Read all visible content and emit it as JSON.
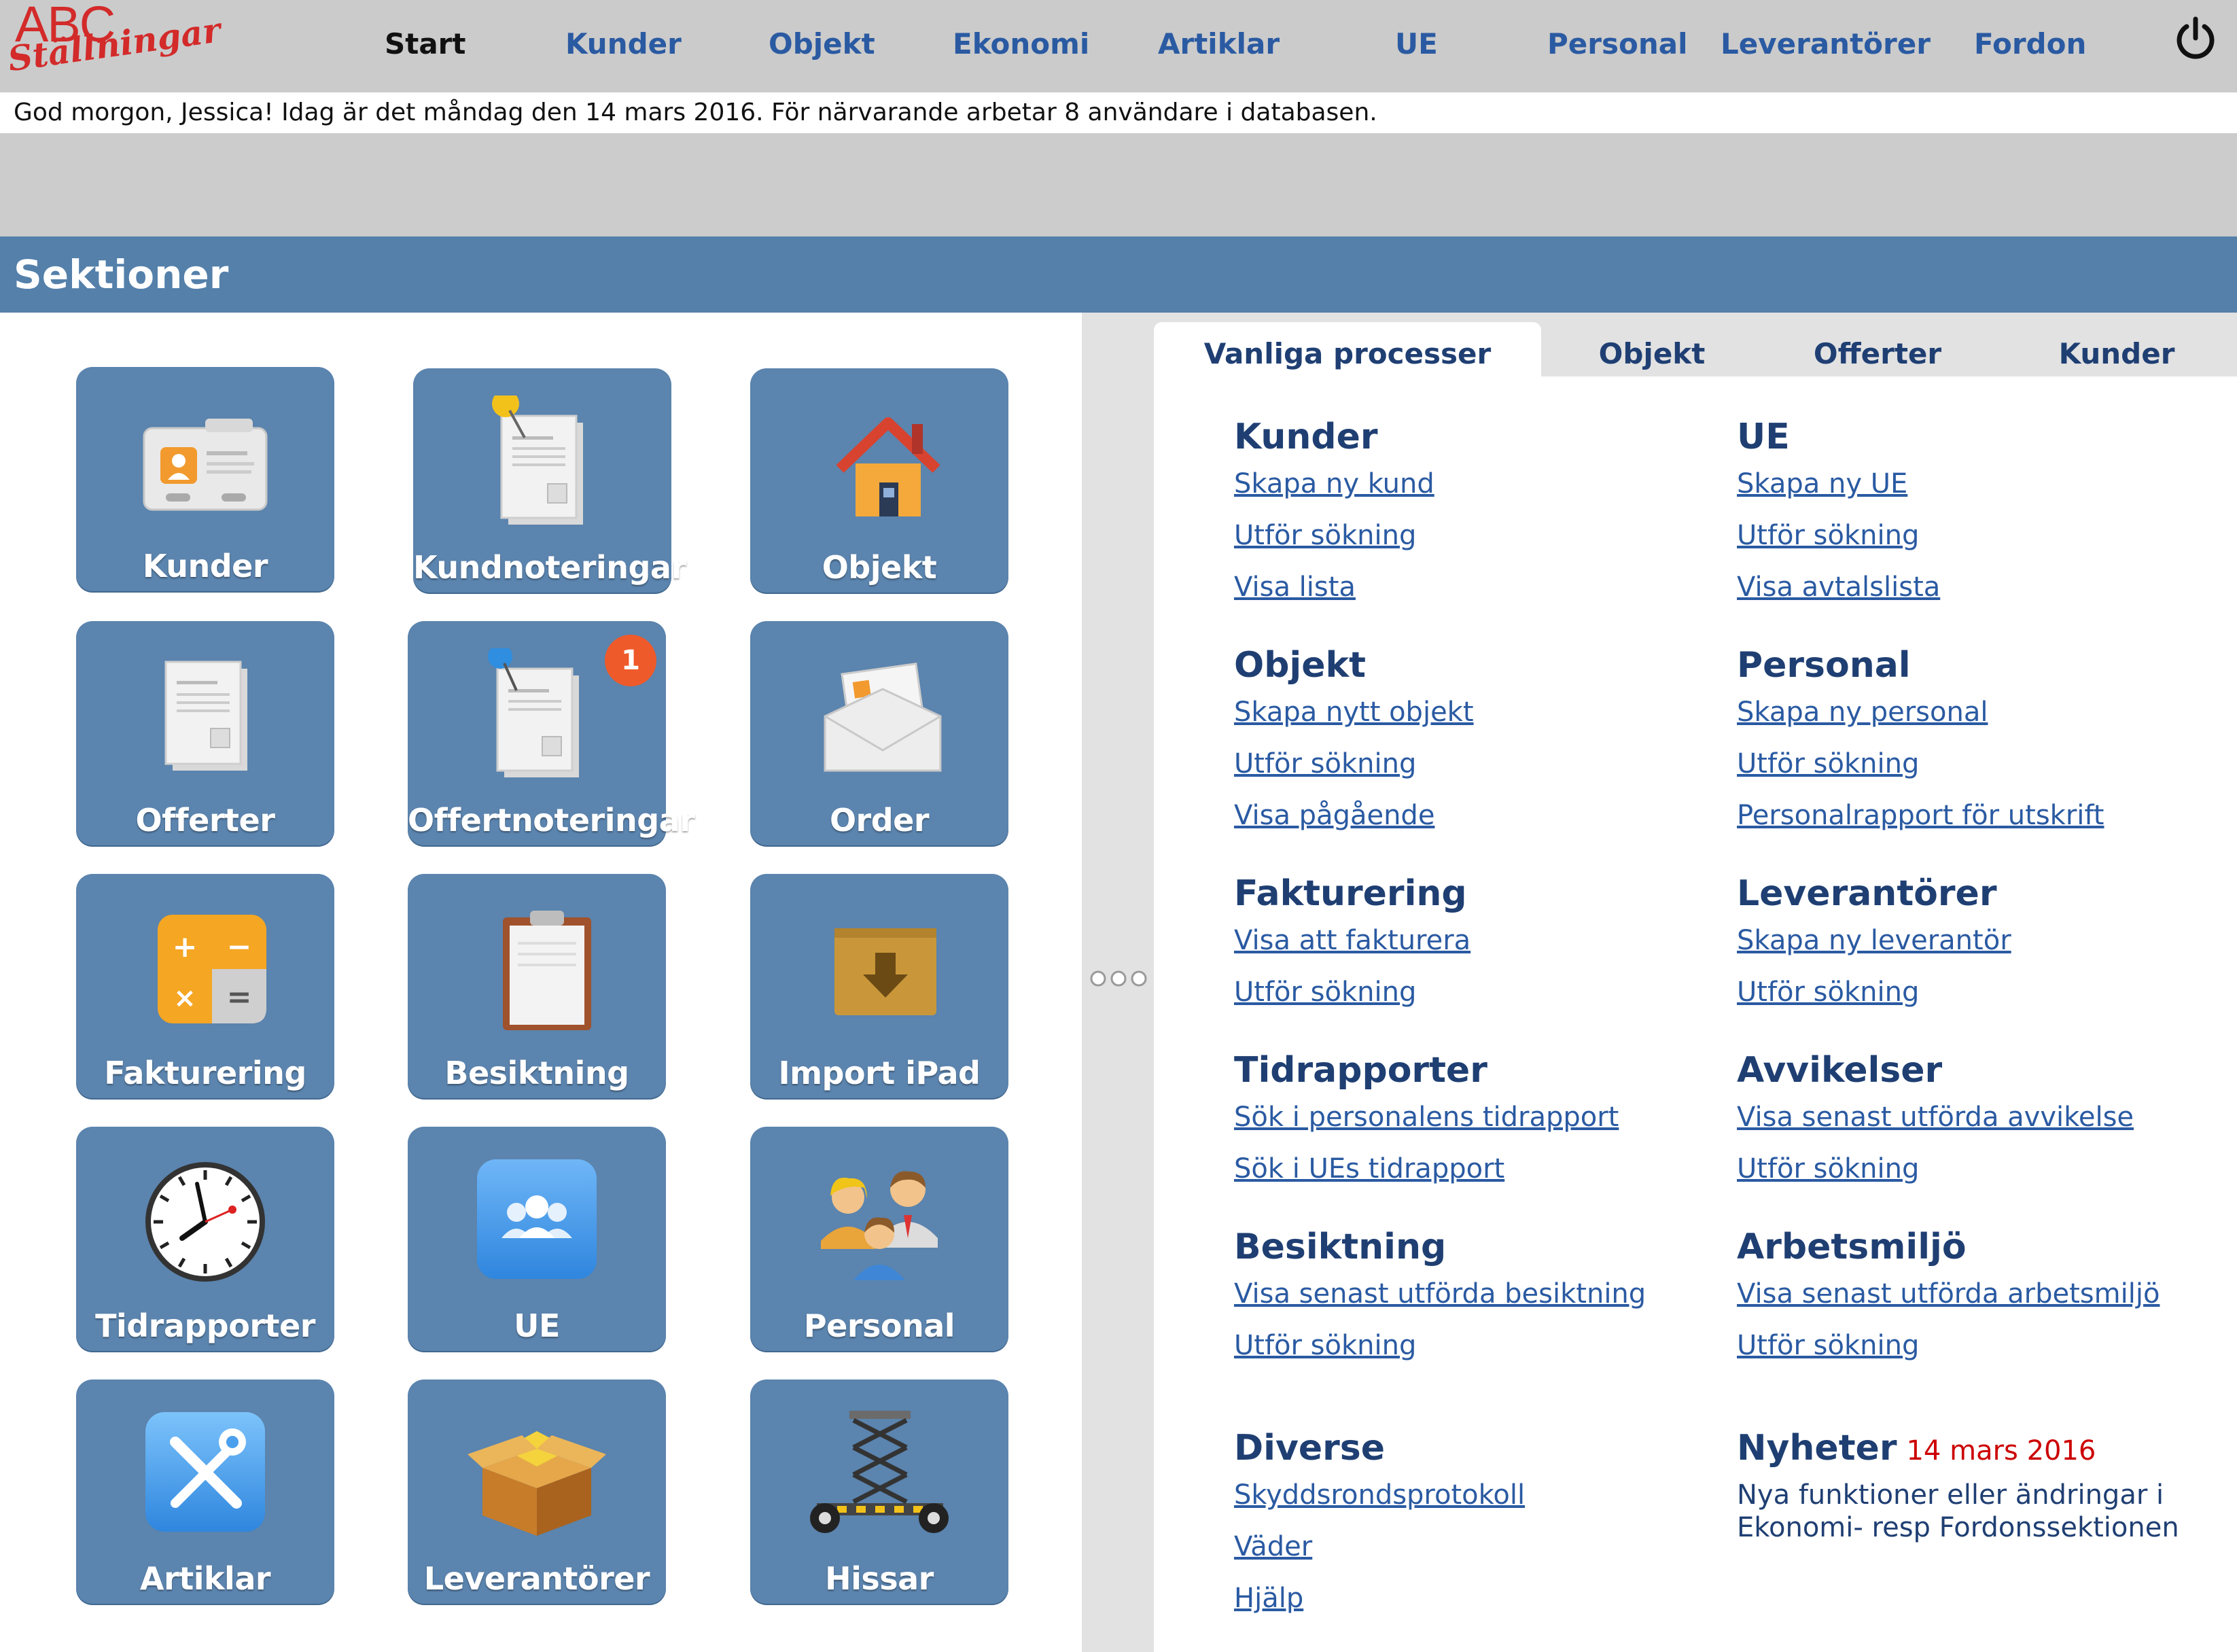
{
  "logo": {
    "line1": "ABC",
    "line2": "Ställningar"
  },
  "nav": {
    "items": [
      "Start",
      "Kunder",
      "Objekt",
      "Ekonomi",
      "Artiklar",
      "UE",
      "Personal",
      "Leverantörer",
      "Fordon"
    ],
    "active": "Start"
  },
  "greeting": "God morgon, Jessica! Idag är det måndag den 14 mars 2016. För närvarande arbetar 8 användare i databasen.",
  "section_title": "Sektioner",
  "tiles": [
    {
      "label": "Kunder",
      "icon": "contact-card-icon"
    },
    {
      "label": "Kundnoteringar",
      "icon": "pinned-note-icon"
    },
    {
      "label": "Objekt",
      "icon": "house-icon"
    },
    {
      "label": "Offerter",
      "icon": "document-icon"
    },
    {
      "label": "Offertnoteringar",
      "icon": "pinned-note-icon",
      "badge": "1"
    },
    {
      "label": "Order",
      "icon": "envelope-icon"
    },
    {
      "label": "Fakturering",
      "icon": "calculator-icon"
    },
    {
      "label": "Besiktning",
      "icon": "clipboard-icon"
    },
    {
      "label": "Import iPad",
      "icon": "download-box-icon"
    },
    {
      "label": "Tidrapporter",
      "icon": "clock-icon"
    },
    {
      "label": "UE",
      "icon": "group-icon"
    },
    {
      "label": "Personal",
      "icon": "people-icon"
    },
    {
      "label": "Artiklar",
      "icon": "tools-icon"
    },
    {
      "label": "Leverantörer",
      "icon": "package-icon"
    },
    {
      "label": "Hissar",
      "icon": "scissor-lift-icon"
    }
  ],
  "tabs": [
    "Vanliga processer",
    "Objekt",
    "Offerter",
    "Kunder"
  ],
  "active_tab": "Vanliga processer",
  "groups": {
    "kunder": {
      "title": "Kunder",
      "links": [
        "Skapa ny kund",
        "Utför sökning",
        "Visa lista"
      ]
    },
    "ue": {
      "title": "UE",
      "links": [
        "Skapa ny UE",
        "Utför sökning",
        "Visa avtalslista"
      ]
    },
    "objekt": {
      "title": "Objekt",
      "links": [
        "Skapa nytt objekt",
        "Utför sökning",
        "Visa pågående"
      ]
    },
    "personal": {
      "title": "Personal",
      "links": [
        "Skapa ny personal",
        "Utför sökning",
        "Personalrapport för utskrift"
      ]
    },
    "fakturering": {
      "title": "Fakturering",
      "links": [
        "Visa att fakturera",
        "Utför sökning"
      ]
    },
    "leverantorer": {
      "title": "Leverantörer",
      "links": [
        "Skapa ny leverantör",
        "Utför sökning"
      ]
    },
    "tidrapporter": {
      "title": "Tidrapporter",
      "links": [
        "Sök i personalens tidrapport",
        "Sök i UEs tidrapport"
      ]
    },
    "avvikelser": {
      "title": "Avvikelser",
      "links": [
        "Visa senast utförda avvikelse",
        "Utför sökning"
      ]
    },
    "besiktning": {
      "title": "Besiktning",
      "links": [
        "Visa senast utförda besiktning",
        "Utför sökning"
      ]
    },
    "arbetsmiljo": {
      "title": "Arbetsmiljö",
      "links": [
        "Visa senast utförda arbetsmiljö",
        "Utför sökning"
      ]
    },
    "diverse": {
      "title": "Diverse",
      "links": [
        "Skyddsrondsprotokoll",
        "Väder",
        "Hjälp"
      ]
    },
    "nyheter": {
      "title": "Nyheter",
      "date": "14 mars 2016",
      "text": "Nya funktioner eller ändringar i Ekonomi- resp Fordonssektionen"
    }
  },
  "colors": {
    "tile": "#5b84ae",
    "section_bar": "#5480aa",
    "heading": "#1f3f73",
    "link": "#2a5aa2",
    "logo": "#d32a2a",
    "badge": "#ef5a2a",
    "news_date": "#cc0000"
  }
}
